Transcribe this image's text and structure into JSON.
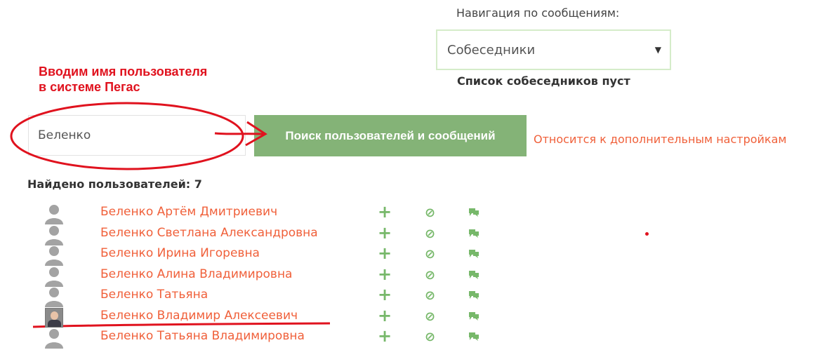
{
  "navigation": {
    "label": "Навигация по сообщениям:",
    "select_value": "Собеседники",
    "empty_message": "Список собеседников пуст"
  },
  "annotations": {
    "hint_line1": "Вводим имя пользователя",
    "hint_line2": "в системе Пегас",
    "color": "#e0121e"
  },
  "search": {
    "value": "Беленко",
    "button_label": "Поиск пользователей и сообщений",
    "advanced_link": "Относится к дополнительным настройкам"
  },
  "results": {
    "found_label": "Найдено пользователей: 7",
    "users": [
      {
        "name": "Беленко Артём Дмитриевич",
        "avatar": "default-user-icon"
      },
      {
        "name": "Беленко Светлана Александровна",
        "avatar": "default-user-icon"
      },
      {
        "name": "Беленко Ирина Игоревна",
        "avatar": "default-user-icon"
      },
      {
        "name": "Беленко Алина Владимировна",
        "avatar": "default-user-icon"
      },
      {
        "name": "Беленко Татьяна",
        "avatar": "default-user-icon"
      },
      {
        "name": "Беленко Владимир Алексеевич",
        "avatar": "user-photo"
      },
      {
        "name": "Беленко Татьяна Владимировна",
        "avatar": "default-user-icon"
      }
    ],
    "actions": {
      "add": "+",
      "block": "⊘",
      "message": "message-icon"
    }
  },
  "colors": {
    "accent_green": "#84b377",
    "link_orange": "#f0603a",
    "icon_green": "#77b86a"
  }
}
